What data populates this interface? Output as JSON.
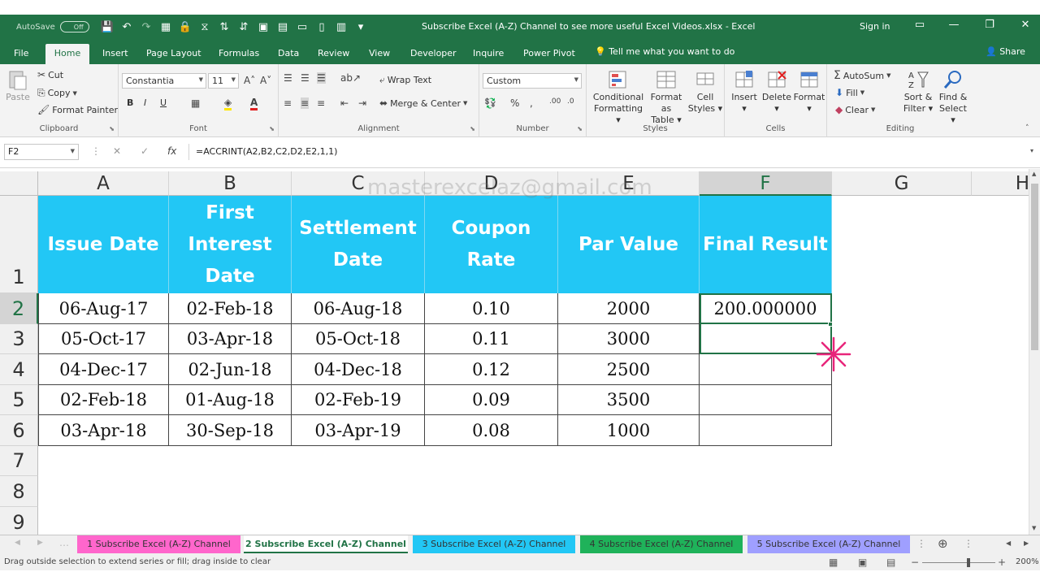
{
  "titlebar": {
    "autosave_label": "AutoSave",
    "autosave_state": "Off",
    "doc_title": "Subscribe Excel (A-Z) Channel to see more useful Excel Videos.xlsx  -  Excel",
    "signin": "Sign in",
    "bg_color": "#217346"
  },
  "tabs": [
    "File",
    "Home",
    "Insert",
    "Page Layout",
    "Formulas",
    "Data",
    "Review",
    "View",
    "Developer",
    "Inquire",
    "Power Pivot"
  ],
  "active_tab": "Home",
  "tellme": "Tell me what you want to do",
  "share": "Share",
  "ribbon": {
    "clipboard": {
      "paste": "Paste",
      "cut": "Cut",
      "copy": "Copy",
      "format_painter": "Format Painter",
      "label": "Clipboard"
    },
    "font": {
      "name": "Constantia",
      "size": "11",
      "bold": "B",
      "italic": "I",
      "underline": "U",
      "label": "Font"
    },
    "alignment": {
      "wrap": "Wrap Text",
      "merge": "Merge & Center",
      "label": "Alignment"
    },
    "number": {
      "format": "Custom",
      "label": "Number"
    },
    "styles": {
      "cond1": "Conditional",
      "cond2": "Formatting",
      "table1": "Format as",
      "table2": "Table",
      "cell1": "Cell",
      "cell2": "Styles",
      "label": "Styles"
    },
    "cells": {
      "insert": "Insert",
      "delete": "Delete",
      "format": "Format",
      "label": "Cells"
    },
    "editing": {
      "autosum": "AutoSum",
      "fill": "Fill",
      "clear": "Clear",
      "sort1": "Sort &",
      "sort2": "Filter",
      "find1": "Find &",
      "find2": "Select",
      "label": "Editing"
    }
  },
  "formula_bar": {
    "name_box": "F2",
    "fx": "fx",
    "formula": "=ACCRINT(A2,B2,C2,D2,E2,1,1)"
  },
  "sheet": {
    "columns": [
      "A",
      "B",
      "C",
      "D",
      "E",
      "F",
      "G",
      "H"
    ],
    "rows": [
      "1",
      "2",
      "3",
      "4",
      "5",
      "6",
      "7",
      "8",
      "9"
    ],
    "selected_column": "F",
    "selected_row": "2",
    "watermark": "masterexcelaz@gmail.com",
    "header_color": "#22c7f5",
    "headers": [
      [
        "Issue Date"
      ],
      [
        "First",
        "Interest",
        "Date"
      ],
      [
        "Settlement",
        "Date"
      ],
      [
        "Coupon",
        "Rate"
      ],
      [
        "Par Value"
      ],
      [
        "Final Result"
      ]
    ],
    "data": [
      [
        "06-Aug-17",
        "02-Feb-18",
        "06-Aug-18",
        "0.10",
        "2000",
        "200.000000"
      ],
      [
        "05-Oct-17",
        "03-Apr-18",
        "05-Oct-18",
        "0.11",
        "3000",
        ""
      ],
      [
        "04-Dec-17",
        "02-Jun-18",
        "04-Dec-18",
        "0.12",
        "2500",
        ""
      ],
      [
        "02-Feb-18",
        "01-Aug-18",
        "02-Feb-19",
        "0.09",
        "3500",
        ""
      ],
      [
        "03-Apr-18",
        "30-Sep-18",
        "03-Apr-19",
        "0.08",
        "1000",
        ""
      ]
    ]
  },
  "sheet_tabs": [
    {
      "label": "1 Subscribe Excel (A-Z) Channel",
      "color": "#ff66cc"
    },
    {
      "label": "2 Subscribe Excel (A-Z) Channel",
      "color": "#ffffff"
    },
    {
      "label": "3 Subscribe Excel (A-Z) Channel",
      "color": "#22c7f5"
    },
    {
      "label": "4 Subscribe Excel (A-Z) Channel",
      "color": "#1fb25a"
    },
    {
      "label": "5 Subscribe Excel (A-Z) Channel",
      "color": "#9f9fff"
    }
  ],
  "active_sheet": "2 Subscribe Excel (A-Z) Channel",
  "status": {
    "message": "Drag outside selection to extend series or fill; drag inside to clear",
    "zoom": "200%"
  }
}
